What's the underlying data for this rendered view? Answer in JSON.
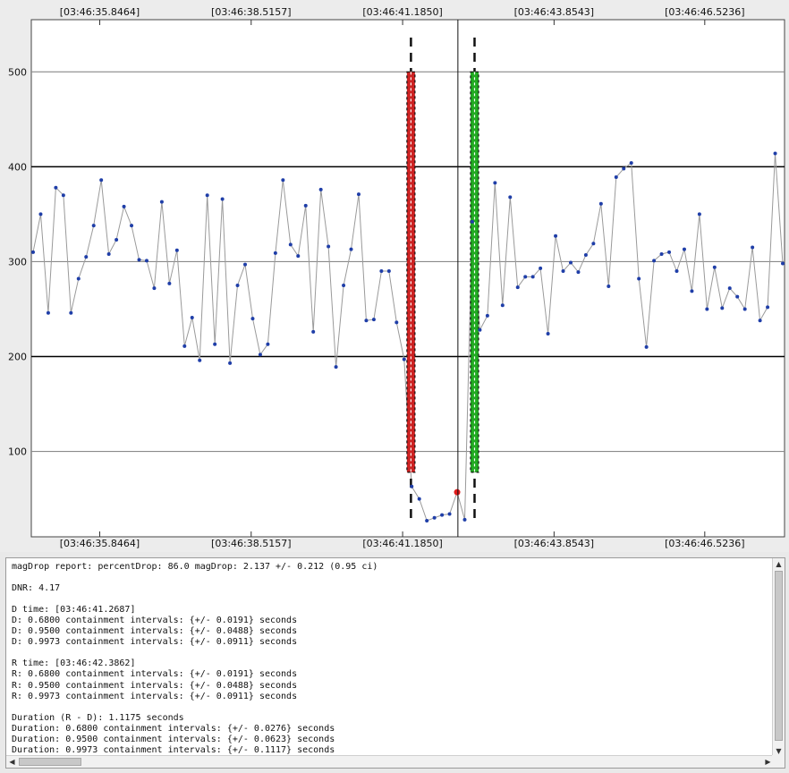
{
  "chart_data": {
    "type": "scatter",
    "title": "",
    "xlabel": "",
    "ylabel": "",
    "x_tick_labels": [
      "[03:46:35.8464]",
      "[03:46:38.5157]",
      "[03:46:41.1850]",
      "[03:46:43.8543]",
      "[03:46:46.5236]"
    ],
    "y_ticks": [
      100,
      200,
      300,
      400,
      500
    ],
    "ylim": [
      10,
      555
    ],
    "grid": true,
    "series": [
      {
        "values": [
          310,
          350,
          246,
          378,
          370,
          246,
          282,
          305,
          338,
          386,
          308,
          323,
          358,
          338,
          302,
          301,
          272,
          363,
          277,
          312,
          211,
          241,
          196,
          370,
          213,
          366,
          193,
          275,
          297,
          240,
          202,
          213,
          309,
          386,
          318,
          306,
          359,
          226,
          376,
          316,
          189,
          275,
          313,
          371,
          238,
          239,
          290,
          290,
          236,
          197,
          63,
          50,
          27,
          30,
          33,
          34,
          57,
          28,
          342,
          228,
          243,
          383,
          254,
          368,
          273,
          284,
          284,
          293,
          224,
          327,
          290,
          299,
          289,
          307,
          319,
          361,
          274,
          389,
          398,
          404,
          282,
          210,
          301,
          308,
          310,
          290,
          313,
          269,
          350,
          250,
          294,
          251,
          272,
          263,
          250,
          315,
          238,
          252,
          414,
          298
        ]
      }
    ],
    "highlight_point": {
      "index": 56,
      "value": 57,
      "color": "#e11b1b"
    },
    "d_marker": {
      "x_index": 49.9,
      "color": "#cc2222",
      "y_range": [
        78,
        500
      ]
    },
    "r_marker": {
      "x_index": 58.3,
      "color": "#22aa22",
      "y_range": [
        78,
        500
      ]
    },
    "cursor_x_index": 56.1,
    "colors": {
      "point": "#1f3ea8",
      "line": "#9a9a9a",
      "grid_major": "#000000",
      "grid_minor": "#8a8a8a"
    }
  },
  "report": {
    "lines": [
      "magDrop report: percentDrop: 86.0 magDrop: 2.137 +/- 0.212 (0.95 ci)",
      "",
      "DNR: 4.17",
      "",
      "D time: [03:46:41.2687]",
      "D: 0.6800 containment intervals: {+/- 0.0191} seconds",
      "D: 0.9500 containment intervals: {+/- 0.0488} seconds",
      "D: 0.9973 containment intervals: {+/- 0.0911} seconds",
      "",
      "R time: [03:46:42.3862]",
      "R: 0.6800 containment intervals: {+/- 0.0191} seconds",
      "R: 0.9500 containment intervals: {+/- 0.0488} seconds",
      "R: 0.9973 containment intervals: {+/- 0.0911} seconds",
      "",
      "Duration (R - D): 1.1175 seconds",
      "Duration: 0.6800 containment intervals: {+/- 0.0276} seconds",
      "Duration: 0.9500 containment intervals: {+/- 0.0623} seconds",
      "Duration: 0.9973 containment intervals: {+/- 0.1117} seconds"
    ],
    "scroll": {
      "up_icon": "scroll-up-icon",
      "down_icon": "scroll-down-icon",
      "left_icon": "scroll-left-icon",
      "right_icon": "scroll-right-icon",
      "up_glyph": "▲",
      "down_glyph": "▼",
      "left_glyph": "◀",
      "right_glyph": "▶"
    }
  }
}
